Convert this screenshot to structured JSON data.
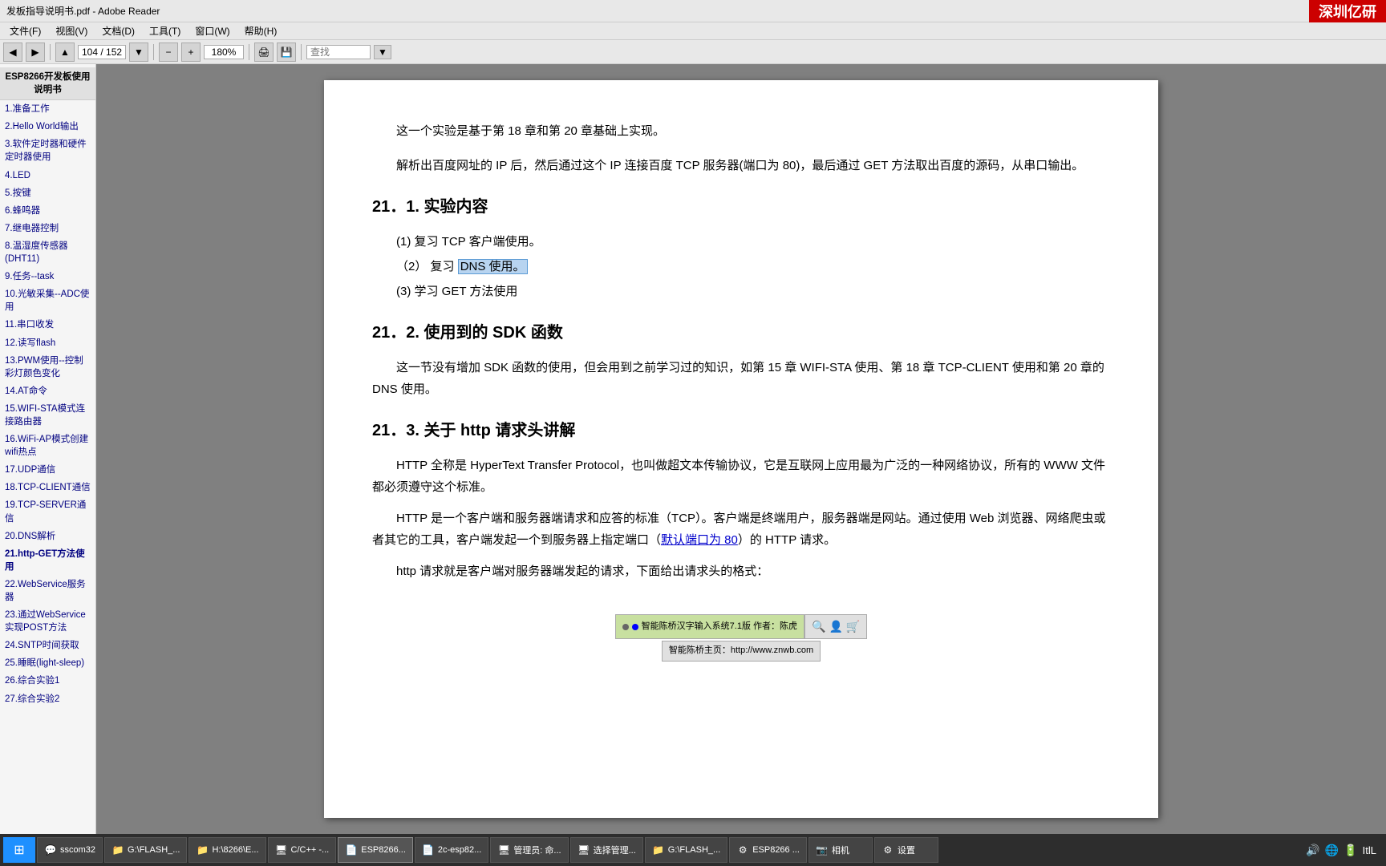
{
  "titlebar": {
    "title": "发板指导说明书.pdf - Adobe Reader",
    "brand": "深圳亿研"
  },
  "menubar": {
    "items": [
      "文件(F)",
      "视图(V)",
      "文档(D)",
      "工具(T)",
      "窗口(W)",
      "帮助(H)"
    ]
  },
  "toolbar": {
    "page_display": "104 / 152",
    "zoom_display": "180%",
    "search_placeholder": "查找"
  },
  "sidebar": {
    "header": "ESP8266开发板使用说明书",
    "items": [
      "1.准备工作",
      "2.Hello World输出",
      "3.软件定时器和硬件定时器使用",
      "4.LED",
      "5.按键",
      "6.蜂鸣器",
      "7.继电器控制",
      "8.温湿度传感器(DHT11)",
      "9.任务--task",
      "10.光敏采集--ADC使用",
      "11.串口收发",
      "12.读写flash",
      "13.PWM使用--控制彩灯颜色变化",
      "14.AT命令",
      "15.WIFI-STA模式连接路由器",
      "16.WiFi-AP模式创建wifi热点",
      "17.UDP通信",
      "18.TCP-CLIENT通信",
      "19.TCP-SERVER通信",
      "20.DNS解析",
      "21.http-GET方法使用",
      "22.WebService服务器",
      "23.通过WebService实现POST方法",
      "24.SNTP时间获取",
      "25.睡眠(light-sleep)",
      "26.综合实验1",
      "27.综合实验2"
    ]
  },
  "pdf": {
    "intro_text": "这一个实验是基于第 18 章和第 20 章基础上实现。",
    "intro2": "解析出百度网址的 IP 后，然后通过这个 IP 连接百度 TCP 服务器(端口为 80)，最后通过 GET 方法取出百度的源码，从串口输出。",
    "section21_1_title": "21．1.    实验内容",
    "list_items": [
      "(1)    复习 TCP 客户端使用。",
      "(2)    复习 DNS 使用。",
      "(3)    学习 GET 方法使用"
    ],
    "dns_highlight": "DNS 使用。",
    "section21_2_title": "21．2.    使用到的 SDK 函数",
    "section21_2_body": "这一节没有增加 SDK 函数的使用，但会用到之前学习过的知识，如第 15 章 WIFI-STA 使用、第 18 章 TCP-CLIENT 使用和第 20 章的 DNS 使用。",
    "section21_3_title": "21．3.    关于 http 请求头讲解",
    "body1": "HTTP 全称是 HyperText Transfer Protocol，也叫做超文本传输协议，它是互联网上应用最为广泛的一种网络协议，所有的 WWW 文件都必须遵守这个标准。",
    "body2": "HTTP 是一个客户端和服务器端请求和应答的标准（TCP）。客户端是终端用户，服务器端是网站。通过使用 Web 浏览器、网络爬虫或者其它的工具，客户端发起一个到服务器上指定端口（默认端口为 80）的 HTTP 请求。",
    "body3": "http 请求就是客户端对服务器端发起的请求，下面给出请求头的格式：",
    "link_text": "默认端口为 80"
  },
  "ime": {
    "left_label": "智能陈桥汉字输入系统7.1版    作者：陈虎",
    "right_label": "智能陈桥主页：http://www.znwb.com",
    "icon1": "🔍",
    "icon2": "👤",
    "icon3": "🛒"
  },
  "taskbar": {
    "start_icon": "⊞",
    "items": [
      {
        "id": "sscom32",
        "label": "sscom32",
        "icon": "💬"
      },
      {
        "id": "gaflash1",
        "label": "G:\\FLASH_...",
        "icon": "📁"
      },
      {
        "id": "h8266",
        "label": "H:\\8266\\E...",
        "icon": "📁"
      },
      {
        "id": "cplusplus",
        "label": "C/C++ -...",
        "icon": "🖥"
      },
      {
        "id": "esp8266",
        "label": "ESP8266...",
        "icon": "📄"
      },
      {
        "id": "2cesp82",
        "label": "2c-esp82...",
        "icon": "📄"
      },
      {
        "id": "manager1",
        "label": "管理员: 命...",
        "icon": "🖥"
      },
      {
        "id": "manager2",
        "label": "选择管理...",
        "icon": "🖥"
      },
      {
        "id": "gaflash2",
        "label": "G:\\FLASH_...",
        "icon": "📁"
      },
      {
        "id": "esp8266b",
        "label": "ESP8266 ...",
        "icon": "⚙"
      },
      {
        "id": "camera",
        "label": "相机",
        "icon": "📷"
      },
      {
        "id": "settings",
        "label": "设置",
        "icon": "⚙"
      }
    ],
    "tray": {
      "time": "ItlL",
      "icons": [
        "🔊",
        "🌐",
        "🔋"
      ]
    }
  }
}
